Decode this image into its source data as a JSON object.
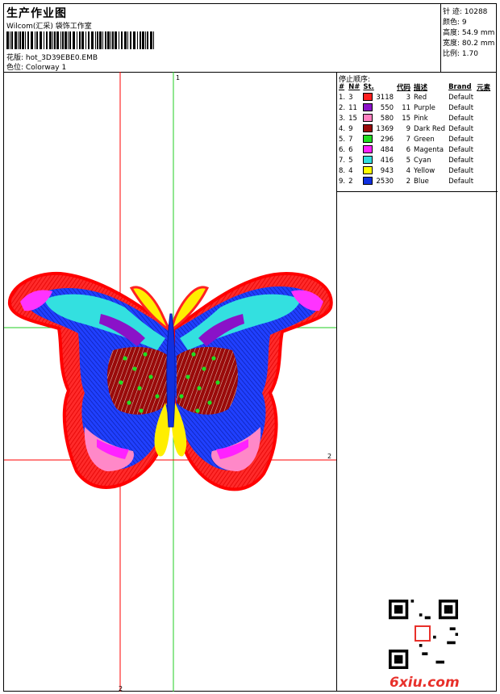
{
  "header": {
    "title": "生产作业图",
    "subtitle": "Wilcom(汇采) 袋饰工作室",
    "pattern_label": "花版:",
    "pattern_value": "hot_3D39EBE0.EMB",
    "colorway_label": "色位:",
    "colorway_value": "Colorway 1"
  },
  "stats": [
    {
      "label": "针 迹:",
      "value": "10288"
    },
    {
      "label": "颜色:",
      "value": "9"
    },
    {
      "label": "高度:",
      "value": "54.9 mm"
    },
    {
      "label": "宽度:",
      "value": "80.2 mm"
    },
    {
      "label": "比例:",
      "value": "1.70"
    }
  ],
  "stop_sequence": {
    "heading": "停止顺序:",
    "columns": [
      "#",
      "N#",
      "St.",
      "代码",
      "描述",
      "Brand",
      "元素"
    ],
    "rows": [
      {
        "idx": "1.",
        "n": "3",
        "color": "#ff2020",
        "st": "3118",
        "code": "3",
        "desc": "Red",
        "brand": "Default"
      },
      {
        "idx": "2.",
        "n": "11",
        "color": "#8a12c8",
        "st": "550",
        "code": "11",
        "desc": "Purple",
        "brand": "Default"
      },
      {
        "idx": "3.",
        "n": "15",
        "color": "#ff80c0",
        "st": "580",
        "code": "15",
        "desc": "Pink",
        "brand": "Default"
      },
      {
        "idx": "4.",
        "n": "9",
        "color": "#9a0a0a",
        "st": "1369",
        "code": "9",
        "desc": "Dark Red",
        "brand": "Default"
      },
      {
        "idx": "5.",
        "n": "7",
        "color": "#22dd22",
        "st": "296",
        "code": "7",
        "desc": "Green",
        "brand": "Default"
      },
      {
        "idx": "6.",
        "n": "6",
        "color": "#ff22ff",
        "st": "484",
        "code": "6",
        "desc": "Magenta",
        "brand": "Default"
      },
      {
        "idx": "7.",
        "n": "5",
        "color": "#33dddd",
        "st": "416",
        "code": "5",
        "desc": "Cyan",
        "brand": "Default"
      },
      {
        "idx": "8.",
        "n": "4",
        "color": "#ffff00",
        "st": "943",
        "code": "4",
        "desc": "Yellow",
        "brand": "Default"
      },
      {
        "idx": "9.",
        "n": "2",
        "color": "#1030e0",
        "st": "2530",
        "code": "2",
        "desc": "Blue",
        "brand": "Default"
      }
    ]
  },
  "axes": {
    "label_1": "1",
    "label_2": "2"
  },
  "watermark": "6xiu.com"
}
